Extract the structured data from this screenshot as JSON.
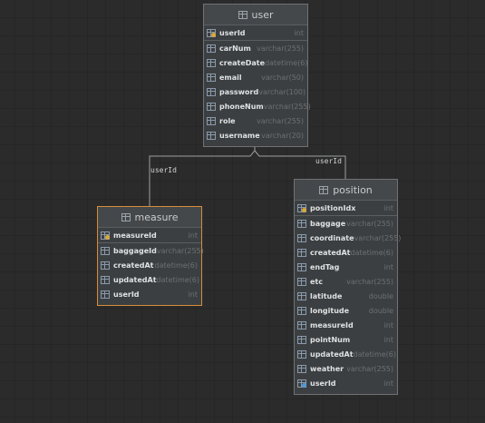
{
  "tables": {
    "user": {
      "name": "user",
      "columns": [
        {
          "name": "userId",
          "type": "int",
          "kind": "pk"
        },
        {
          "name": "carNum",
          "type": "varchar(255)",
          "kind": "col"
        },
        {
          "name": "createDate",
          "type": "datetime(6)",
          "kind": "col"
        },
        {
          "name": "email",
          "type": "varchar(50)",
          "kind": "col"
        },
        {
          "name": "password",
          "type": "varchar(100)",
          "kind": "col"
        },
        {
          "name": "phoneNum",
          "type": "varchar(255)",
          "kind": "col"
        },
        {
          "name": "role",
          "type": "varchar(255)",
          "kind": "col"
        },
        {
          "name": "username",
          "type": "varchar(20)",
          "kind": "col"
        }
      ]
    },
    "measure": {
      "name": "measure",
      "columns": [
        {
          "name": "measureId",
          "type": "int",
          "kind": "pk"
        },
        {
          "name": "baggageId",
          "type": "varchar(255)",
          "kind": "col"
        },
        {
          "name": "createdAt",
          "type": "datetime(6)",
          "kind": "col"
        },
        {
          "name": "updatedAt",
          "type": "datetime(6)",
          "kind": "col"
        },
        {
          "name": "userId",
          "type": "int",
          "kind": "col"
        }
      ]
    },
    "position": {
      "name": "position",
      "columns": [
        {
          "name": "positionIdx",
          "type": "int",
          "kind": "pk"
        },
        {
          "name": "baggage",
          "type": "varchar(255)",
          "kind": "col"
        },
        {
          "name": "coordinate",
          "type": "varchar(255)",
          "kind": "col"
        },
        {
          "name": "createdAt",
          "type": "datetime(6)",
          "kind": "col"
        },
        {
          "name": "endTag",
          "type": "int",
          "kind": "col"
        },
        {
          "name": "etc",
          "type": "varchar(255)",
          "kind": "col"
        },
        {
          "name": "latitude",
          "type": "double",
          "kind": "col"
        },
        {
          "name": "longitude",
          "type": "double",
          "kind": "col"
        },
        {
          "name": "measureId",
          "type": "int",
          "kind": "col"
        },
        {
          "name": "pointNum",
          "type": "int",
          "kind": "col"
        },
        {
          "name": "updatedAt",
          "type": "datetime(6)",
          "kind": "col"
        },
        {
          "name": "weather",
          "type": "varchar(255)",
          "kind": "col"
        },
        {
          "name": "userId",
          "type": "int",
          "kind": "fk"
        }
      ]
    }
  },
  "relations": {
    "measure_user_label": "userId",
    "position_user_label": "userId"
  },
  "colors": {
    "background": "#2b2b2b",
    "table_border": "#6f7274",
    "selected_border": "#d98c3a",
    "connector": "#9c9fa2"
  }
}
